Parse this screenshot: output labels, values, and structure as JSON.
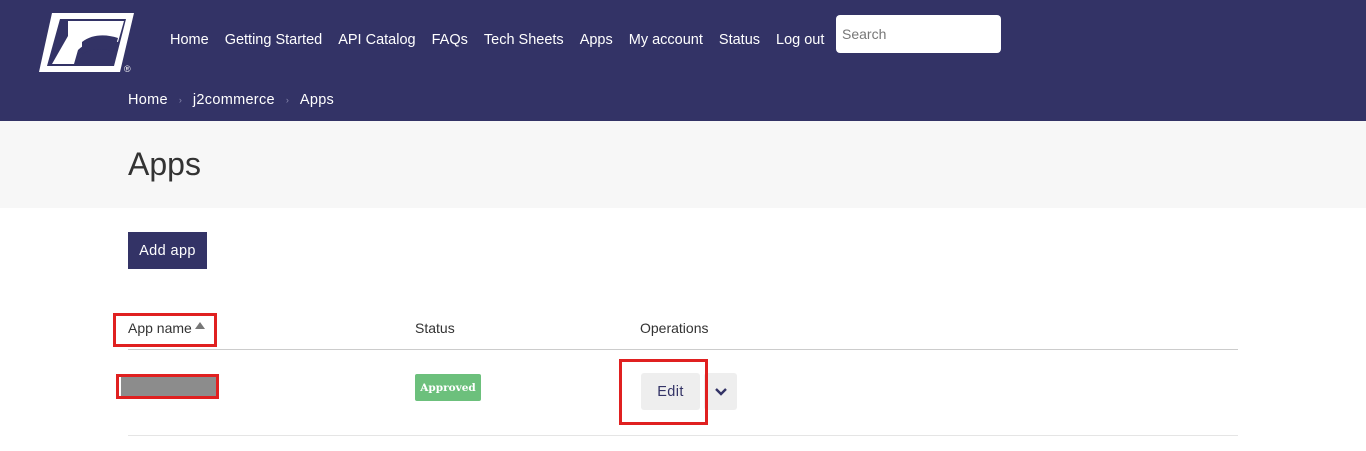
{
  "nav": {
    "items": [
      "Home",
      "Getting Started",
      "API Catalog",
      "FAQs",
      "Tech Sheets",
      "Apps",
      "My account",
      "Status",
      "Log out"
    ]
  },
  "search": {
    "placeholder": "Search"
  },
  "breadcrumb": {
    "items": [
      "Home",
      "j2commerce",
      "Apps"
    ]
  },
  "page": {
    "title": "Apps"
  },
  "actions": {
    "add_app": "Add app"
  },
  "table": {
    "headers": {
      "name": "App name",
      "status": "Status",
      "operations": "Operations"
    },
    "rows": [
      {
        "name": "",
        "status": "Approved",
        "edit": "Edit"
      }
    ]
  },
  "colors": {
    "brand": "#333366",
    "approved": "#6cc07c",
    "highlight": "#e02020"
  },
  "icons": {
    "logo": "usps-eagle-logo",
    "sort": "sort-ascending-icon",
    "dropdown": "chevron-down-icon"
  }
}
